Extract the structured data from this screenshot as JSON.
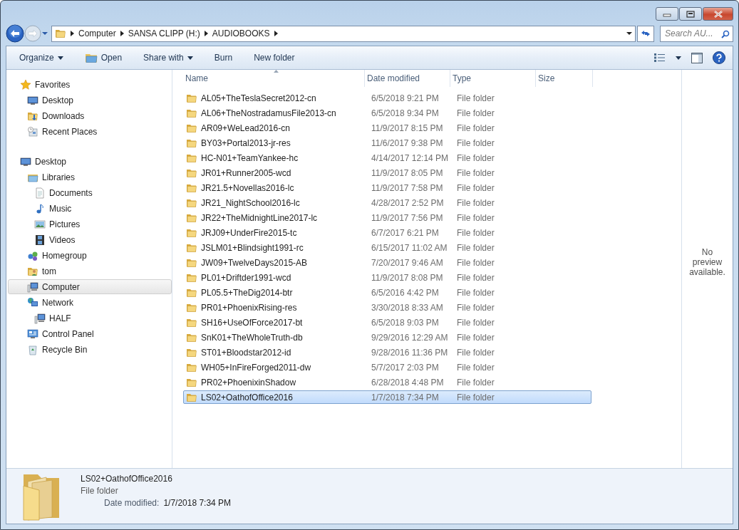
{
  "address": {
    "crumbs": [
      "Computer",
      "SANSA CLIPP (H:)",
      "AUDIOBOOKS"
    ]
  },
  "search": {
    "placeholder": "Search AU..."
  },
  "toolbar": {
    "buttons": [
      {
        "label": "Organize",
        "kind": "menu"
      },
      {
        "label": "Open",
        "kind": "icon"
      },
      {
        "label": "Share with",
        "kind": "menu"
      },
      {
        "label": "Burn",
        "kind": "plain"
      },
      {
        "label": "New folder",
        "kind": "plain"
      }
    ]
  },
  "sidebar": {
    "groups": [
      {
        "label": "Favorites",
        "kind": "star",
        "selected": false,
        "children": [
          {
            "label": "Desktop",
            "kind": "desktop",
            "selected": false
          },
          {
            "label": "Downloads",
            "kind": "downloads",
            "selected": false
          },
          {
            "label": "Recent Places",
            "kind": "recent",
            "selected": false
          }
        ]
      },
      {
        "label": "Desktop",
        "kind": "desktop",
        "selected": false,
        "children": [
          {
            "label": "Libraries",
            "kind": "libraries",
            "selected": false,
            "children": [
              {
                "label": "Documents",
                "kind": "document",
                "selected": false
              },
              {
                "label": "Music",
                "kind": "music",
                "selected": false
              },
              {
                "label": "Pictures",
                "kind": "picture",
                "selected": false
              },
              {
                "label": "Videos",
                "kind": "video",
                "selected": false
              }
            ]
          },
          {
            "label": "Homegroup",
            "kind": "homegroup",
            "selected": false
          },
          {
            "label": "tom",
            "kind": "user",
            "selected": false
          },
          {
            "label": "Computer",
            "kind": "computer",
            "selected": true
          },
          {
            "label": "Network",
            "kind": "network",
            "selected": false,
            "children": [
              {
                "label": "HALF",
                "kind": "computer",
                "selected": false
              }
            ]
          },
          {
            "label": "Control Panel",
            "kind": "control",
            "selected": false
          },
          {
            "label": "Recycle Bin",
            "kind": "bin",
            "selected": false
          }
        ]
      }
    ]
  },
  "table": {
    "columns": [
      {
        "label": "Name",
        "sorted": true
      },
      {
        "label": "Date modified",
        "sorted": false
      },
      {
        "label": "Type",
        "sorted": false
      },
      {
        "label": "Size",
        "sorted": false
      }
    ],
    "rows": [
      {
        "name": "AL05+TheTeslaSecret2012-cn",
        "date": "6/5/2018 9:21 PM",
        "type": "File folder",
        "selected": false
      },
      {
        "name": "AL06+TheNostradamusFile2013-cn",
        "date": "6/5/2018 9:34 PM",
        "type": "File folder",
        "selected": false
      },
      {
        "name": "AR09+WeLead2016-cn",
        "date": "11/9/2017 8:15 PM",
        "type": "File folder",
        "selected": false
      },
      {
        "name": "BY03+Portal2013-jr-res",
        "date": "11/6/2017 9:38 PM",
        "type": "File folder",
        "selected": false
      },
      {
        "name": "HC-N01+TeamYankee-hc",
        "date": "4/14/2017 12:14 PM",
        "type": "File folder",
        "selected": false
      },
      {
        "name": "JR01+Runner2005-wcd",
        "date": "11/9/2017 8:05 PM",
        "type": "File folder",
        "selected": false
      },
      {
        "name": "JR21.5+Novellas2016-lc",
        "date": "11/9/2017 7:58 PM",
        "type": "File folder",
        "selected": false
      },
      {
        "name": "JR21_NightSchool2016-lc",
        "date": "4/28/2017 2:52 PM",
        "type": "File folder",
        "selected": false
      },
      {
        "name": "JR22+TheMidnightLine2017-lc",
        "date": "11/9/2017 7:56 PM",
        "type": "File folder",
        "selected": false
      },
      {
        "name": "JRJ09+UnderFire2015-tc",
        "date": "6/7/2017 6:21 PM",
        "type": "File folder",
        "selected": false
      },
      {
        "name": "JSLM01+Blindsight1991-rc",
        "date": "6/15/2017 11:02 AM",
        "type": "File folder",
        "selected": false
      },
      {
        "name": "JW09+TwelveDays2015-AB",
        "date": "7/20/2017 9:46 AM",
        "type": "File folder",
        "selected": false
      },
      {
        "name": "PL01+Driftder1991-wcd",
        "date": "11/9/2017 8:08 PM",
        "type": "File folder",
        "selected": false
      },
      {
        "name": "PL05.5+TheDig2014-btr",
        "date": "6/5/2016 4:42 PM",
        "type": "File folder",
        "selected": false
      },
      {
        "name": "PR01+PhoenixRising-res",
        "date": "3/30/2018 8:33 AM",
        "type": "File folder",
        "selected": false
      },
      {
        "name": "SH16+UseOfForce2017-bt",
        "date": "6/5/2018 9:03 PM",
        "type": "File folder",
        "selected": false
      },
      {
        "name": "SnK01+TheWholeTruth-db",
        "date": "9/29/2016 12:29 AM",
        "type": "File folder",
        "selected": false
      },
      {
        "name": "ST01+Bloodstar2012-id",
        "date": "9/28/2016 11:36 PM",
        "type": "File folder",
        "selected": false
      },
      {
        "name": "WH05+InFireForged2011-dw",
        "date": "5/7/2017 2:03 PM",
        "type": "File folder",
        "selected": false
      },
      {
        "name": "PR02+PhoenixinShadow",
        "date": "6/28/2018 4:48 PM",
        "type": "File folder",
        "selected": false
      },
      {
        "name": "LS02+OathofOffice2016",
        "date": "1/7/2018 7:34 PM",
        "type": "File folder",
        "selected": true
      }
    ]
  },
  "preview": {
    "message": "No preview available."
  },
  "details": {
    "name": "LS02+OathofOffice2016",
    "type": "File folder",
    "date_label": "Date modified:",
    "date_value": "1/7/2018 7:34 PM"
  }
}
